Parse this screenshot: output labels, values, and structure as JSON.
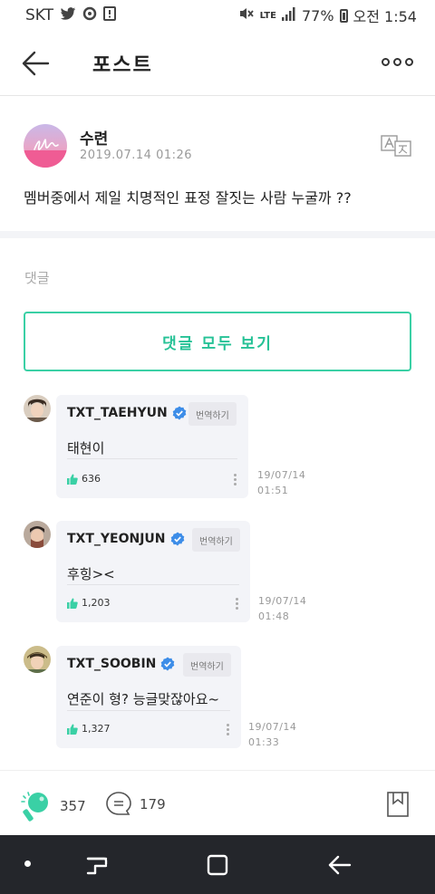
{
  "status": {
    "carrier": "SKT",
    "network": "LTE",
    "battery": "77%",
    "time": "오전 1:54"
  },
  "header": {
    "title": "포스트"
  },
  "post": {
    "author": "수련",
    "date": "2019.07.14 01:26",
    "body": "멤버중에서 제일 치명적인 표정 잘짓는 사람 누굴까 ??"
  },
  "comments_section": {
    "heading": "댓글",
    "view_all_label": "댓글 모두 보기",
    "items": [
      {
        "name": "TXT_TAEHYUN",
        "translate": "번역하기",
        "text": "태현이",
        "likes": "636",
        "date": "19/07/14",
        "time": "01:51"
      },
      {
        "name": "TXT_YEONJUN",
        "translate": "번역하기",
        "text": "후힝><",
        "likes": "1,203",
        "date": "19/07/14",
        "time": "01:48"
      },
      {
        "name": "TXT_SOOBIN",
        "translate": "번역하기",
        "text": "연준이 형? 능글맞잖아요~",
        "likes": "1,327",
        "date": "19/07/14",
        "time": "01:33"
      }
    ]
  },
  "actions": {
    "cheer_count": "357",
    "comment_count": "179"
  },
  "colors": {
    "accent": "#26c296",
    "bubble": "#f3f4f8",
    "verified": "#3d8de8",
    "navbar": "#24262b"
  }
}
